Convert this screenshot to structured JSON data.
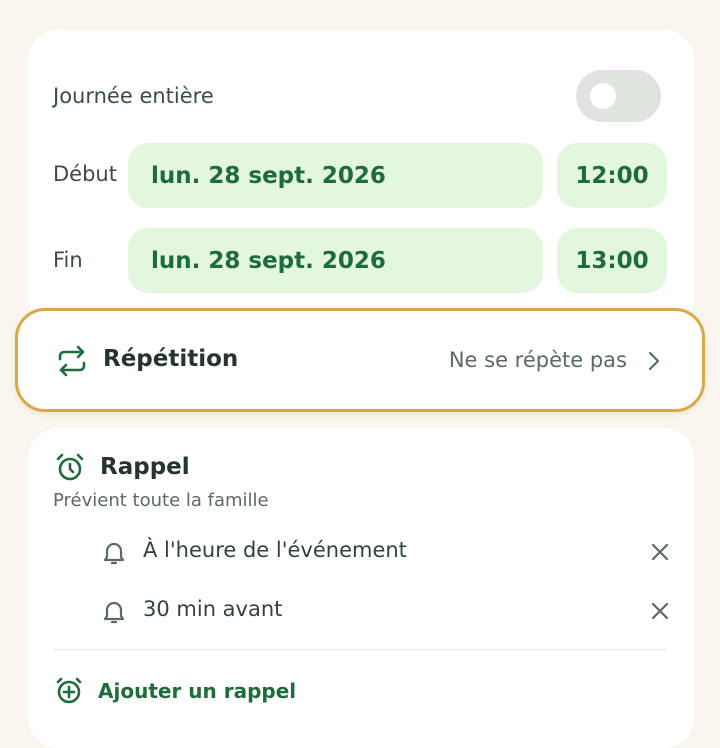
{
  "all_day": {
    "label": "Journée entière",
    "enabled": false
  },
  "start": {
    "label": "Début",
    "date": "lun. 28 sept. 2026",
    "time": "12:00"
  },
  "end": {
    "label": "Fin",
    "date": "lun. 28 sept. 2026",
    "time": "13:00"
  },
  "repeat": {
    "title": "Répétition",
    "value": "Ne se répète pas"
  },
  "reminder": {
    "title": "Rappel",
    "subtitle": "Prévient toute la famille",
    "items": [
      {
        "label": "À l'heure de l'événement"
      },
      {
        "label": "30 min avant"
      }
    ],
    "add_label": "Ajouter un rappel"
  },
  "colors": {
    "accent_green": "#1e6c3a",
    "pill_bg": "#e2f7de",
    "highlight_border": "#dca748"
  }
}
